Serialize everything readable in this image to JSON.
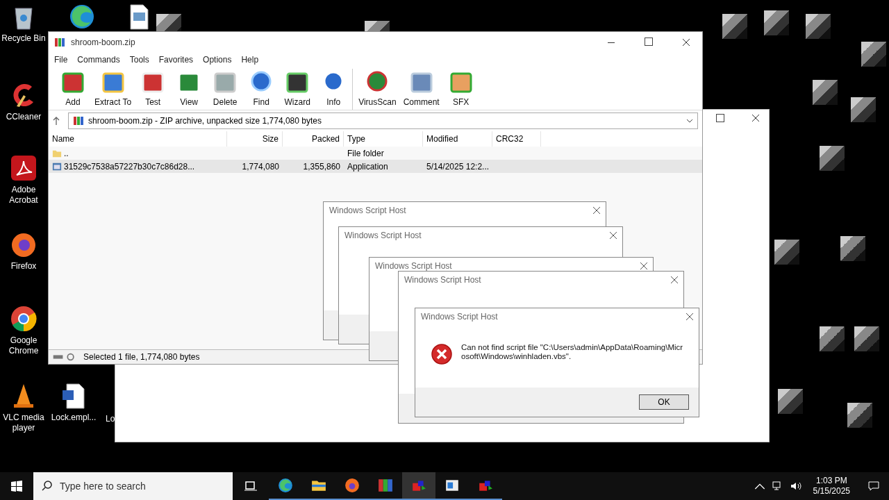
{
  "desktop_icons": [
    {
      "kind": "recycle",
      "label": "Recycle Bin"
    },
    {
      "kind": "edge"
    },
    {
      "kind": "image"
    },
    {
      "kind": "ccleaner",
      "label": "CCleaner"
    },
    {
      "kind": "acrobat",
      "label": "Adobe Acrobat"
    },
    {
      "kind": "firefox",
      "label": "Firefox"
    },
    {
      "kind": "chrome",
      "label": "Google Chrome"
    },
    {
      "kind": "vlc",
      "label": "VLC media player"
    },
    {
      "kind": "word",
      "label": "Lock.empl..."
    },
    {
      "kind": "blank",
      "label": "Lo"
    }
  ],
  "winrar": {
    "title": "shroom-boom.zip",
    "menu": [
      "File",
      "Commands",
      "Tools",
      "Favorites",
      "Options",
      "Help"
    ],
    "toolbar": [
      {
        "kind": "books",
        "label": "Add"
      },
      {
        "kind": "folder",
        "label": "Extract To"
      },
      {
        "kind": "clipboard",
        "label": "Test"
      },
      {
        "kind": "book",
        "label": "View"
      },
      {
        "kind": "trash",
        "label": "Delete"
      },
      {
        "kind": "magnifier",
        "label": "Find"
      },
      {
        "kind": "wand",
        "label": "Wizard"
      },
      {
        "kind": "info",
        "label": "Info"
      },
      {
        "kind": "shield",
        "label": "VirusScan"
      },
      {
        "kind": "speech",
        "label": "Comment"
      },
      {
        "kind": "box",
        "label": "SFX"
      }
    ],
    "address": "shroom-boom.zip - ZIP archive, unpacked size 1,774,080 bytes",
    "columns": [
      "Name",
      "Size",
      "Packed",
      "Type",
      "Modified",
      "CRC32"
    ],
    "rows": [
      {
        "kind": "folder",
        "name": "..",
        "size": "",
        "packed": "",
        "type": "File folder",
        "modified": "",
        "selected": false
      },
      {
        "kind": "app",
        "name": "31529c7538a57227b30c7c86d28...",
        "size": "1,774,080",
        "packed": "1,355,860",
        "type": "Application",
        "modified": "5/14/2025 12:2...",
        "selected": true
      }
    ],
    "status": "Selected 1 file, 1,774,080 bytes"
  },
  "dialogs": [
    {
      "title": "Windows Script Host"
    },
    {
      "title": "Windows Script Host"
    },
    {
      "title": "Windows Script Host"
    },
    {
      "title": "Windows Script Host"
    },
    {
      "title": "Windows Script Host",
      "message": "Can not find script file \"C:\\Users\\admin\\AppData\\Roaming\\Microsoft\\Windows\\winhladen.vbs\".",
      "button": "OK"
    }
  ],
  "taskbar": {
    "search": {
      "placeholder": "Type here to search"
    },
    "apps": [
      {
        "kind": "edge",
        "active": false
      },
      {
        "kind": "explorer",
        "active": false
      },
      {
        "kind": "firefox",
        "active": false
      },
      {
        "kind": "winrar",
        "active": false
      },
      {
        "kind": "wsh",
        "active": true
      },
      {
        "kind": "notepad",
        "active": false
      },
      {
        "kind": "wsh",
        "active": false
      }
    ],
    "time": "1:03 PM",
    "date": "5/15/2025"
  }
}
